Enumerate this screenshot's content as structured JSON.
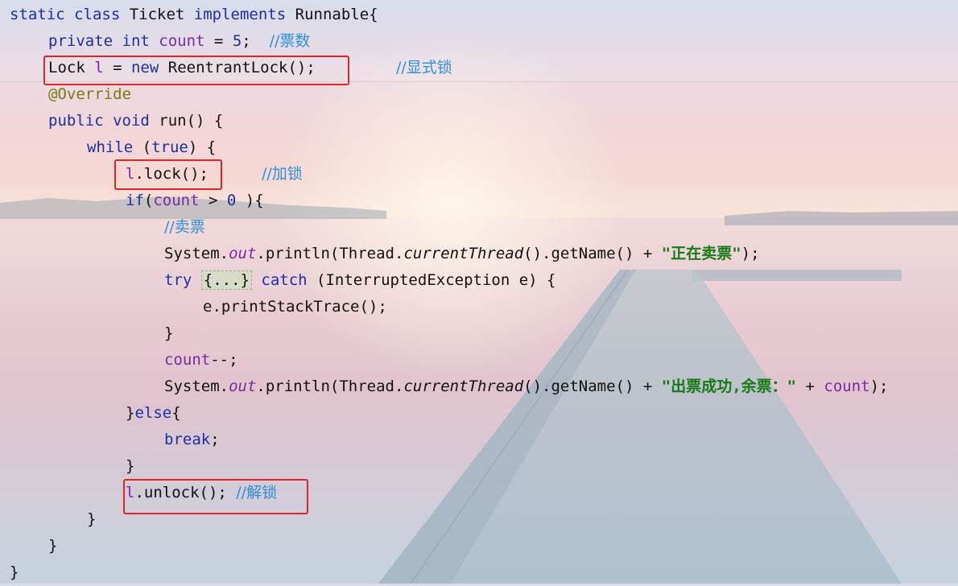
{
  "code": {
    "l1": {
      "t1": "static class ",
      "t2": "Ticket ",
      "t3": "implements ",
      "t4": "Runnable{"
    },
    "l2": {
      "kw": "private int ",
      "fld": "count",
      "t1": " = ",
      "num": "5",
      "t2": ";  ",
      "cm": "//票数"
    },
    "l3": {
      "t1": "Lock ",
      "fld": "l",
      "t2": " = ",
      "kw": "new ",
      "t3": "ReentrantLock();",
      "cm": "//显式锁"
    },
    "l4": {
      "ann": "@Override"
    },
    "l5": {
      "kw": "public void ",
      "t1": "run() {"
    },
    "l6": {
      "kw1": "while ",
      "t1": "(",
      "kw2": "true",
      "t2": ") {"
    },
    "l7": {
      "fld": "l",
      "t1": ".lock();",
      "cm": "//加锁"
    },
    "l8": {
      "kw": "if",
      "t1": "(",
      "fld": "count",
      "t2": " > ",
      "num": "0",
      "t3": " ){"
    },
    "l9": {
      "cm": "//卖票"
    },
    "l10": {
      "t1": "System.",
      "fld": "out",
      "t2": ".println(Thread.",
      "it": "currentThread",
      "t3": "().getName() + ",
      "str": "\"正在卖票\"",
      "t4": ");"
    },
    "l11": {
      "kw1": "try ",
      "fold": "{...}",
      "kw2": " catch ",
      "t1": "(InterruptedException e) {"
    },
    "l12": {
      "t1": "e.printStackTrace();"
    },
    "l13": {
      "t1": "}"
    },
    "l14": {
      "fld": "count",
      "t1": "--;"
    },
    "l15": {
      "t1": "System.",
      "fld": "out",
      "t2": ".println(Thread.",
      "it": "currentThread",
      "t3": "().getName() + ",
      "str": "\"出票成功,余票：\"",
      "t4": " + ",
      "fld2": "count",
      "t5": ");"
    },
    "l16": {
      "t1": "}",
      "kw": "else",
      "t2": "{"
    },
    "l17": {
      "kw": "break",
      "t1": ";"
    },
    "l18": {
      "t1": "}"
    },
    "l19": {
      "fld": "l",
      "t1": ".unlock(); ",
      "cm": "//解锁"
    },
    "l20": {
      "t1": "}"
    },
    "l21": {
      "t1": "}"
    },
    "l22": {
      "t1": "}"
    }
  },
  "colors": {
    "keyword": "#1a2fa8",
    "field": "#7a2aa0",
    "comment": "#2f8fd8",
    "string": "#177a17",
    "annotation": "#7a7a10",
    "highlight_box": "#e1232a"
  }
}
